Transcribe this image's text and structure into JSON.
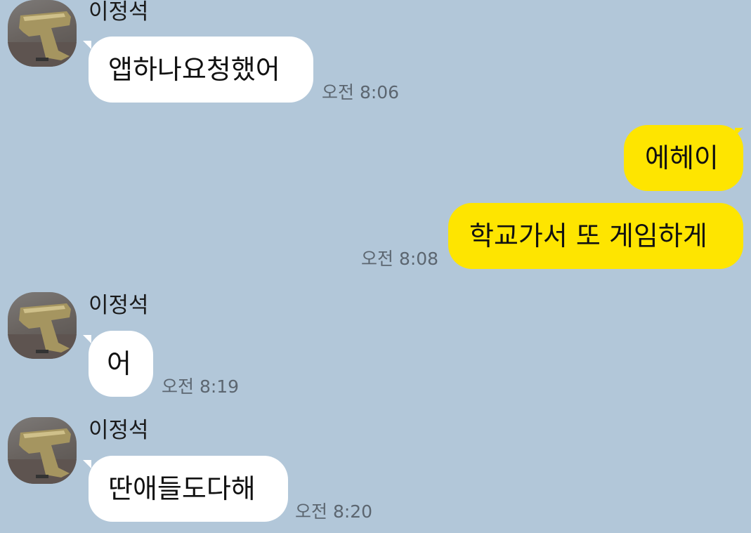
{
  "chat": {
    "messages": [
      {
        "direction": "incoming",
        "sender": "이정석",
        "text": "앱하나요청했어",
        "time": "오전 8:06",
        "avatar_icon": "pistol-avatar-icon"
      },
      {
        "direction": "outgoing",
        "text": "에헤이"
      },
      {
        "direction": "outgoing",
        "text": "학교가서 또 게임하게",
        "time": "오전 8:08"
      },
      {
        "direction": "incoming",
        "sender": "이정석",
        "text": "어",
        "time": "오전 8:19",
        "avatar_icon": "pistol-avatar-icon"
      },
      {
        "direction": "incoming",
        "sender": "이정석",
        "text": "딴애들도다해",
        "time": "오전 8:20",
        "avatar_icon": "pistol-avatar-icon"
      }
    ]
  },
  "colors": {
    "background": "#b2c7d9",
    "incoming_bubble": "#ffffff",
    "outgoing_bubble": "#fee500",
    "timestamp": "#5c6670"
  }
}
